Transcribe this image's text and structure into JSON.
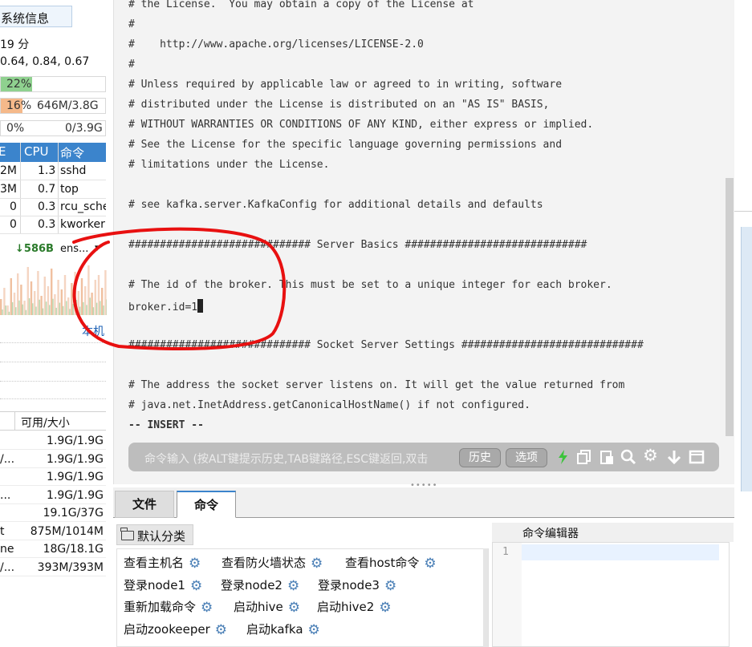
{
  "left_panel": {
    "title": "系统信息",
    "uptime": "19 分",
    "load": "0.64, 0.84, 0.67",
    "cpu_bar": {
      "text": "22%",
      "percent": 22,
      "color": "#8fd18f"
    },
    "mem_bar": {
      "text_pct": "16%",
      "text_val": "646M/3.8G",
      "percent": 16,
      "color": "#f5b98a"
    },
    "swap_bar": {
      "text_pct": "0%",
      "text_val": "0/3.9G",
      "percent": 0
    },
    "process_table": {
      "headers": [
        "E",
        "CPU",
        "命令"
      ],
      "rows": [
        {
          "mem": "2M",
          "cpu": "1.3",
          "cmd": "sshd"
        },
        {
          "mem": "3M",
          "cpu": "0.7",
          "cmd": "top"
        },
        {
          "mem": "0",
          "cpu": "0.3",
          "cmd": "rcu_sche"
        },
        {
          "mem": "0",
          "cpu": "0.3",
          "cmd": "kworker"
        }
      ]
    },
    "network": {
      "speed": "↓586B",
      "interface": "ens...",
      "dropdown": "▾"
    },
    "local_label": "本机",
    "disk_table": {
      "header": "可用/大小",
      "rows": [
        {
          "name": "",
          "value": "1.9G/1.9G"
        },
        {
          "name": "/...",
          "value": "1.9G/1.9G"
        },
        {
          "name": "",
          "value": "1.9G/1.9G"
        },
        {
          "name": "...",
          "value": "1.9G/1.9G"
        },
        {
          "name": "",
          "value": "19.1G/37G"
        },
        {
          "name": "t",
          "value": "875M/1014M"
        },
        {
          "name": "ne",
          "value": "18G/18.1G"
        },
        {
          "name": "/...",
          "value": "393M/393M"
        }
      ]
    }
  },
  "terminal": {
    "lines": [
      "# the License.  You may obtain a copy of the License at",
      "#",
      "#    http://www.apache.org/licenses/LICENSE-2.0",
      "#",
      "# Unless required by applicable law or agreed to in writing, software",
      "# distributed under the License is distributed on an \"AS IS\" BASIS,",
      "# WITHOUT WARRANTIES OR CONDITIONS OF ANY KIND, either express or implied.",
      "# See the License for the specific language governing permissions and",
      "# limitations under the License.",
      "",
      "# see kafka.server.KafkaConfig for additional details and defaults",
      "",
      "############################# Server Basics #############################",
      "",
      "# The id of the broker. This must be set to a unique integer for each broker.",
      "broker.id=1",
      "",
      "############################# Socket Server Settings #############################",
      "",
      "# The address the socket server listens on. It will get the value returned from",
      "# java.net.InetAddress.getCanonicalHostName() if not configured.",
      "-- INSERT --"
    ],
    "annotation_color": "#e81010"
  },
  "command_bar": {
    "placeholder": "命令输入 (按ALT键提示历史,TAB键路径,ESC键返回,双击",
    "history_button": "历史",
    "options_button": "选项",
    "icons": [
      "lightning-icon",
      "copy-icon",
      "paste-icon",
      "search-icon",
      "gear-icon",
      "download-icon",
      "window-icon"
    ]
  },
  "bottom_tabs": [
    "文件",
    "命令"
  ],
  "category": {
    "label": "默认分类"
  },
  "commands": [
    [
      "查看主机名",
      "查看防火墙状态",
      "查看host命令"
    ],
    [
      "登录node1",
      "登录node2",
      "登录node3"
    ],
    [
      "重新加载命令",
      "启动hive",
      "启动hive2"
    ],
    [
      "启动zookeeper",
      "启动kafka"
    ]
  ],
  "editor": {
    "title": "命令编辑器",
    "line_number": "1"
  }
}
